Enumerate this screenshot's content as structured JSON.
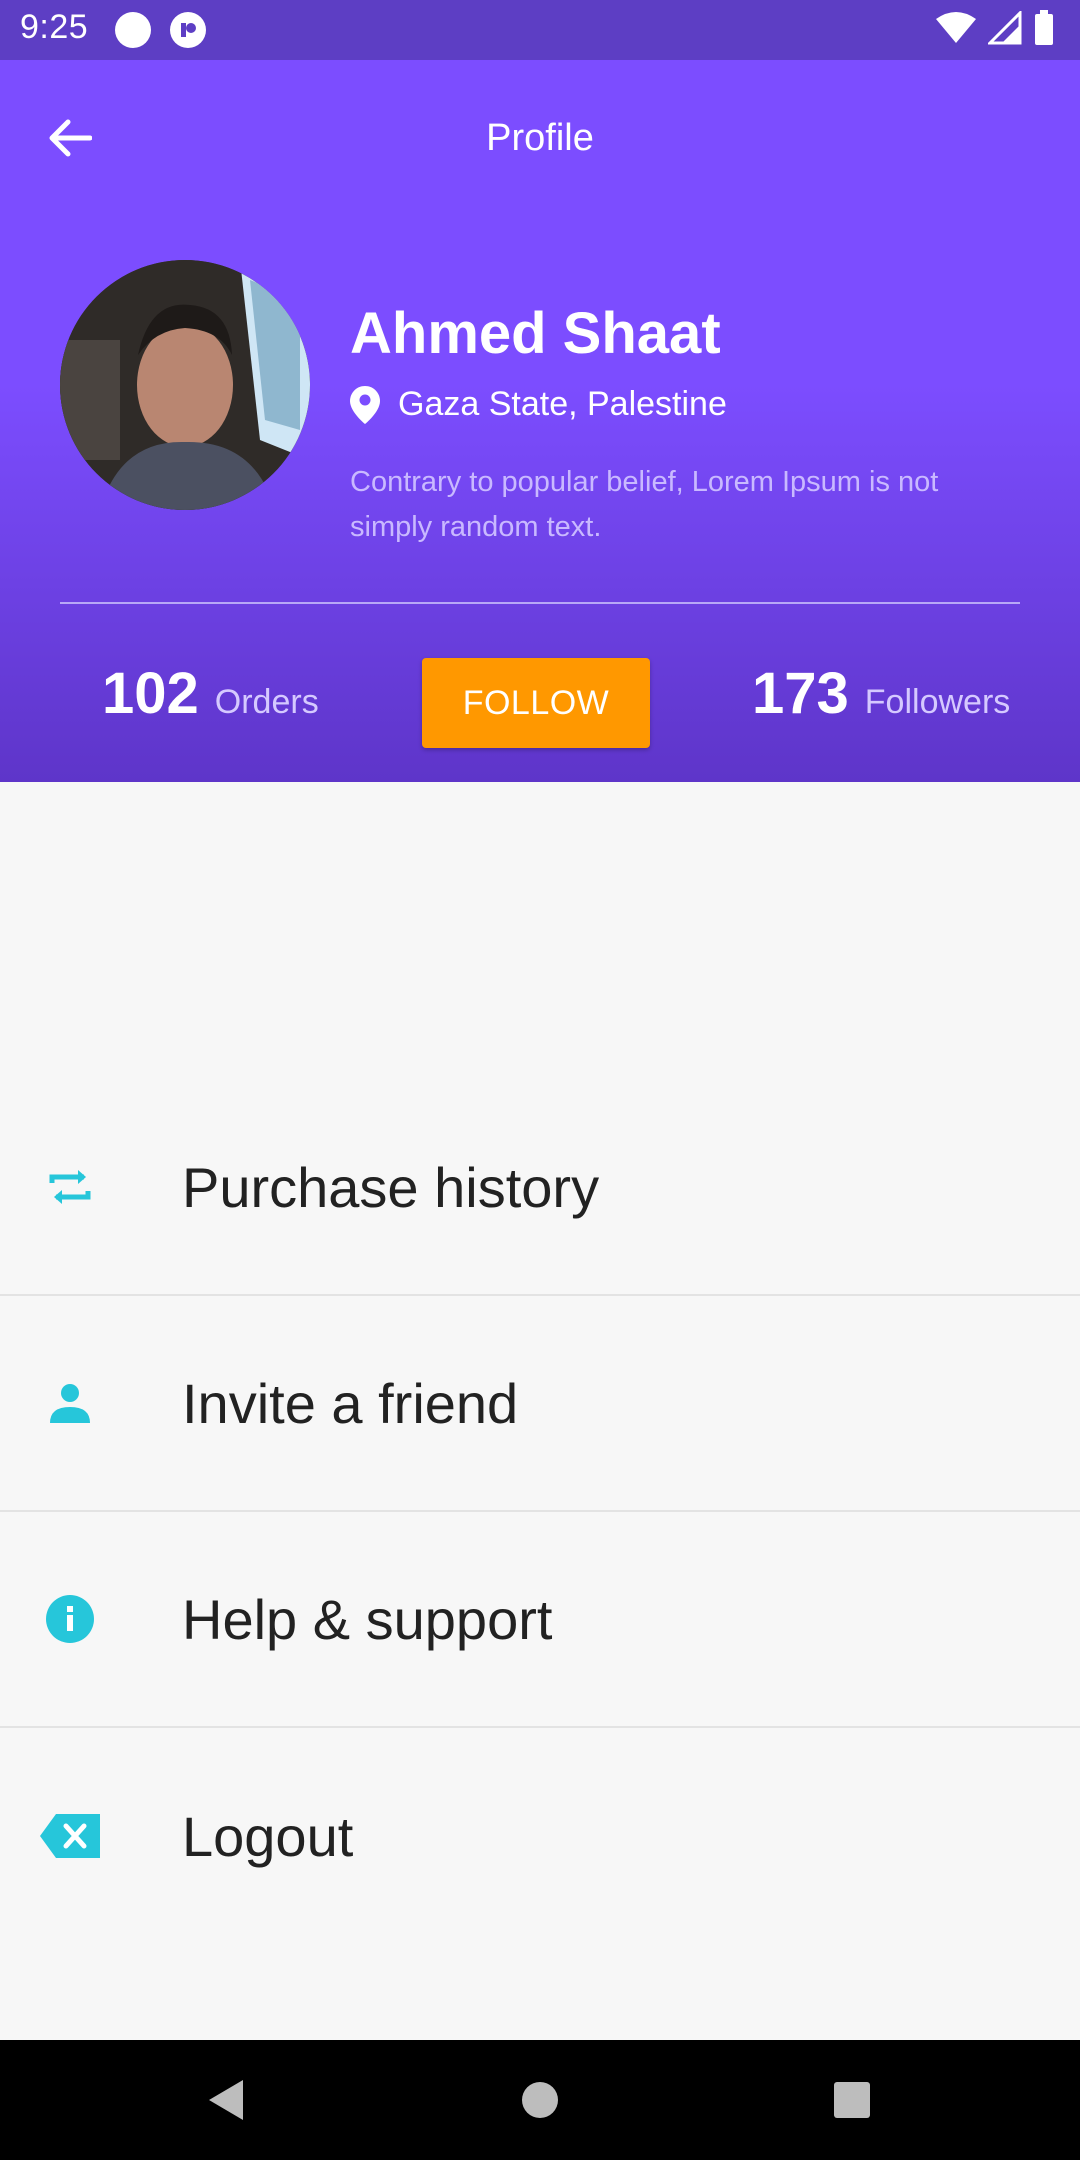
{
  "status_bar": {
    "time": "9:25"
  },
  "header": {
    "title": "Profile"
  },
  "profile": {
    "name": "Ahmed Shaat",
    "location": "Gaza State, Palestine",
    "bio": "Contrary to popular belief, Lorem Ipsum is not simply random text."
  },
  "stats": {
    "orders": {
      "value": "102",
      "label": "Orders"
    },
    "followers": {
      "value": "173",
      "label": "Followers"
    },
    "follow_label": "FOLLOW"
  },
  "menu": {
    "items": [
      {
        "label": "Purchase history",
        "icon": "repeat-icon"
      },
      {
        "label": "Invite a friend",
        "icon": "person-icon"
      },
      {
        "label": "Help & support",
        "icon": "info-icon"
      },
      {
        "label": "Logout",
        "icon": "backspace-icon"
      }
    ]
  },
  "colors": {
    "header_primary": "#7c4dff",
    "header_dark": "#5e35c9",
    "status_bar": "#5d3ec4",
    "follow_button": "#ff9800",
    "menu_icon": "#26c6da"
  }
}
